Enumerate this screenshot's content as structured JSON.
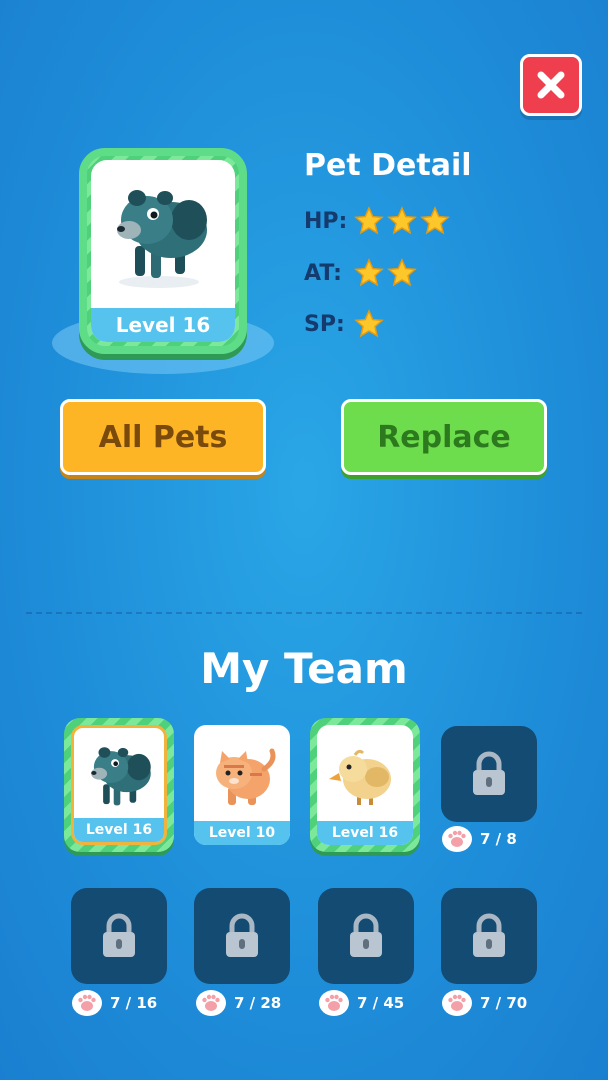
{
  "detail": {
    "title": "Pet Detail",
    "pet_level": "Level 16",
    "stats": [
      {
        "label": "HP:",
        "stars": 3
      },
      {
        "label": "AT:",
        "stars": 2
      },
      {
        "label": "SP:",
        "stars": 1
      }
    ]
  },
  "buttons": {
    "all_pets": "All Pets",
    "replace": "Replace"
  },
  "team": {
    "title": "My Team",
    "pets": [
      {
        "level": "Level 16",
        "animal": "bear",
        "selected": true
      },
      {
        "level": "Level 10",
        "animal": "cat",
        "selected": false
      },
      {
        "level": "Level 16",
        "animal": "bird",
        "selected": false
      }
    ],
    "locked_slots": [
      {
        "requirement": "7 / 8"
      },
      {
        "requirement": "7 / 16"
      },
      {
        "requirement": "7 / 28"
      },
      {
        "requirement": "7 / 45"
      },
      {
        "requirement": "7 / 70"
      }
    ]
  },
  "icons": {
    "close": "close-icon",
    "star": "star-icon",
    "lock": "lock-icon",
    "paw": "paw-icon"
  },
  "colors": {
    "background": "#1f8fda",
    "close_button": "#ef3f4e",
    "all_pets_button": "#fdb526",
    "replace_button": "#6ddc4d",
    "frame_green": "#5fdc87",
    "level_strip": "#55c3ee",
    "locked_slot": "#144b73",
    "stat_label": "#143a6e",
    "star": "#fcc72a"
  }
}
